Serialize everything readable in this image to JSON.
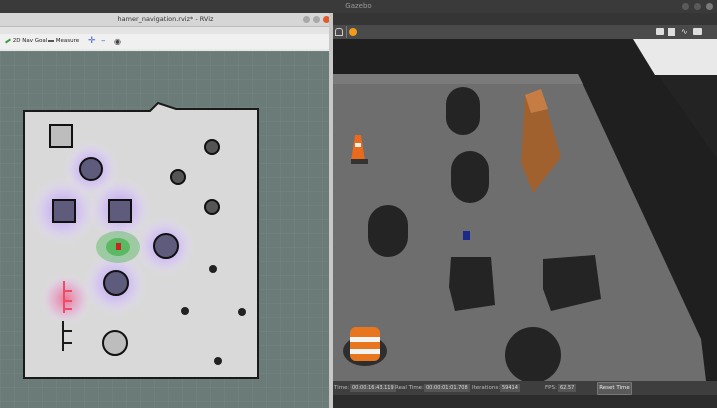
{
  "gazebo": {
    "title": "Gazebo",
    "status": {
      "time_label": "Time:",
      "time_value": "00:00:16:43.119",
      "real_time_label": "Real Time:",
      "real_time_value": "00:00:01:01.708",
      "iterations_label": "Iterations:",
      "iterations_value": "59414",
      "fps_label": "FPS:",
      "fps_value": "62.57",
      "reset_label": "Reset Time"
    }
  },
  "rviz": {
    "title": "hamer_navigation.rviz* - RViz",
    "toolbar": {
      "nav_goal": "2D Nav Goal",
      "measure": "Measure"
    }
  },
  "colors": {
    "map_free": "#d9d9d9",
    "map_bg": "#6b7b78",
    "costmap_inflation": "#c9b3ef",
    "robot": "#cc2222",
    "particles": "#2fae3a"
  }
}
